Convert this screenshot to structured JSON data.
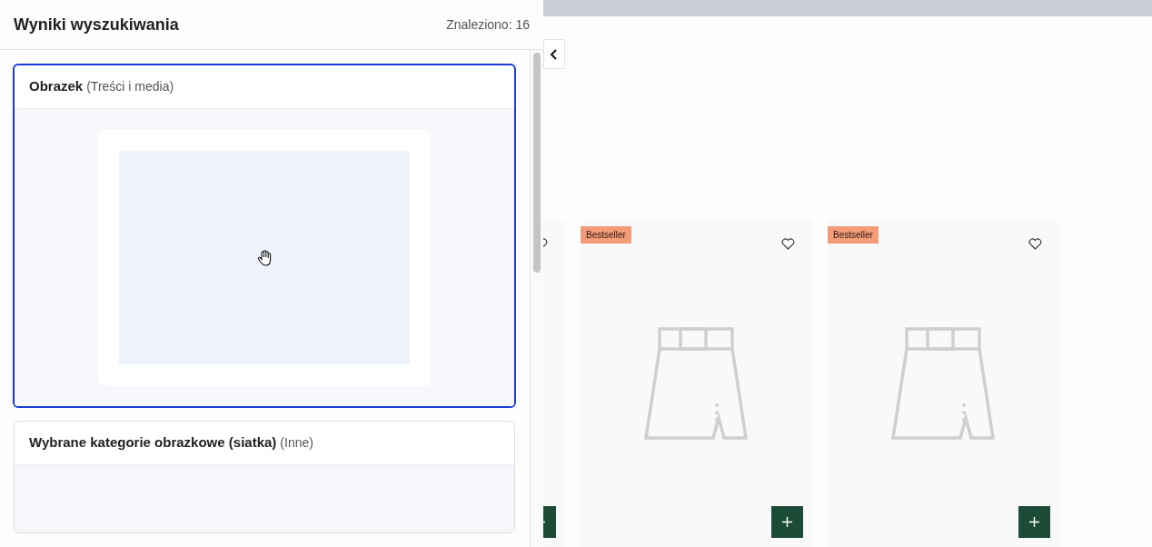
{
  "panel": {
    "title": "Wyniki wyszukiwania",
    "count": "Znaleziono: 16"
  },
  "results": [
    {
      "name": "Obrazek",
      "category": "(Treści i media)",
      "selected": true,
      "kind": "image"
    },
    {
      "name": "Wybrane kategorie obrazkowe (siatka)",
      "category": "(Inne)",
      "selected": false,
      "kind": "empty"
    }
  ],
  "products": [
    {
      "kind": "partial"
    },
    {
      "kind": "full",
      "badge": "Bestseller"
    },
    {
      "kind": "full",
      "badge": "Bestseller"
    }
  ]
}
